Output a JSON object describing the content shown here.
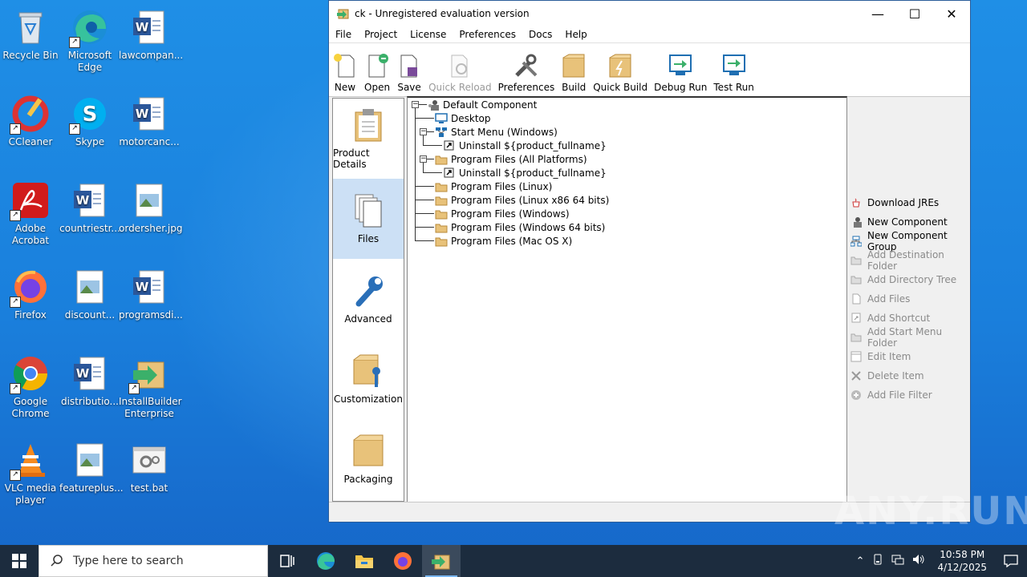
{
  "desktop": {
    "icons": [
      {
        "label": "Recycle Bin",
        "icon": "recycle-bin-icon"
      },
      {
        "label": "Microsoft Edge",
        "icon": "edge-icon"
      },
      {
        "label": "lawcompan...",
        "icon": "word-doc-icon"
      },
      {
        "label": "CCleaner",
        "icon": "ccleaner-icon"
      },
      {
        "label": "Skype",
        "icon": "skype-icon"
      },
      {
        "label": "motorcanc...",
        "icon": "word-doc-icon"
      },
      {
        "label": "Adobe Acrobat",
        "icon": "acrobat-icon"
      },
      {
        "label": "countriestr...",
        "icon": "word-doc-icon"
      },
      {
        "label": "ordersher.jpg",
        "icon": "image-file-icon"
      },
      {
        "label": "Firefox",
        "icon": "firefox-icon"
      },
      {
        "label": "discount...",
        "icon": "image-file-icon"
      },
      {
        "label": "programsdi...",
        "icon": "word-doc-icon"
      },
      {
        "label": "Google Chrome",
        "icon": "chrome-icon"
      },
      {
        "label": "distributio...",
        "icon": "word-doc-icon"
      },
      {
        "label": "InstallBuilder Enterprise",
        "icon": "installbuilder-icon"
      },
      {
        "label": "VLC media player",
        "icon": "vlc-icon"
      },
      {
        "label": "featureplus...",
        "icon": "image-file-icon"
      },
      {
        "label": "test.bat",
        "icon": "bat-file-icon"
      }
    ]
  },
  "window": {
    "title": "ck - Unregistered evaluation version",
    "controls": {
      "minimize": "—",
      "maximize": "☐",
      "close": "✕"
    },
    "menu": [
      "File",
      "Project",
      "License",
      "Preferences",
      "Docs",
      "Help"
    ],
    "toolbar": [
      {
        "label": "New",
        "enabled": true
      },
      {
        "label": "Open",
        "enabled": true
      },
      {
        "label": "Save",
        "enabled": true
      },
      {
        "label": "Quick Reload",
        "enabled": false
      },
      {
        "label": "Preferences",
        "enabled": true
      },
      {
        "label": "Build",
        "enabled": true
      },
      {
        "label": "Quick Build",
        "enabled": true
      },
      {
        "label": "Debug Run",
        "enabled": true
      },
      {
        "label": "Test Run",
        "enabled": true
      }
    ],
    "nav": [
      {
        "label": "Product Details",
        "selected": false
      },
      {
        "label": "Files",
        "selected": true
      },
      {
        "label": "Advanced",
        "selected": false
      },
      {
        "label": "Customization",
        "selected": false
      },
      {
        "label": "Packaging",
        "selected": false
      }
    ],
    "tree": [
      {
        "label": "Default Component",
        "icon": "component-icon"
      },
      {
        "label": "Desktop",
        "icon": "desktop-icon"
      },
      {
        "label": "Start Menu (Windows)",
        "icon": "start-menu-icon"
      },
      {
        "label": "Uninstall ${product_fullname}",
        "icon": "shortcut-icon"
      },
      {
        "label": "Program Files (All Platforms)",
        "icon": "folder-icon"
      },
      {
        "label": "Uninstall ${product_fullname}",
        "icon": "shortcut-icon"
      },
      {
        "label": "Program Files (Linux)",
        "icon": "folder-icon"
      },
      {
        "label": "Program Files (Linux x86 64 bits)",
        "icon": "folder-icon"
      },
      {
        "label": "Program Files (Windows)",
        "icon": "folder-icon"
      },
      {
        "label": "Program Files (Windows 64 bits)",
        "icon": "folder-icon"
      },
      {
        "label": "Program Files (Mac OS X)",
        "icon": "folder-icon"
      }
    ],
    "actions": [
      {
        "label": "Download JREs",
        "enabled": true,
        "icon": "java-icon"
      },
      {
        "label": "New Component",
        "enabled": true,
        "icon": "component-icon"
      },
      {
        "label": "New Component Group",
        "enabled": true,
        "icon": "component-group-icon"
      },
      {
        "label": "Add Destination Folder",
        "enabled": false,
        "icon": "folder-icon"
      },
      {
        "label": "Add Directory Tree",
        "enabled": false,
        "icon": "folder-icon"
      },
      {
        "label": "Add Files",
        "enabled": false,
        "icon": "file-icon"
      },
      {
        "label": "Add Shortcut",
        "enabled": false,
        "icon": "shortcut-icon"
      },
      {
        "label": "Add Start Menu Folder",
        "enabled": false,
        "icon": "folder-icon"
      },
      {
        "label": "Edit Item",
        "enabled": false,
        "icon": "edit-icon"
      },
      {
        "label": "Delete Item",
        "enabled": false,
        "icon": "delete-icon"
      },
      {
        "label": "Add File Filter",
        "enabled": false,
        "icon": "add-icon"
      }
    ]
  },
  "taskbar": {
    "search_placeholder": "Type here to search",
    "time": "10:58 PM",
    "date": "4/12/2025"
  },
  "watermark": "ANY.RUN"
}
